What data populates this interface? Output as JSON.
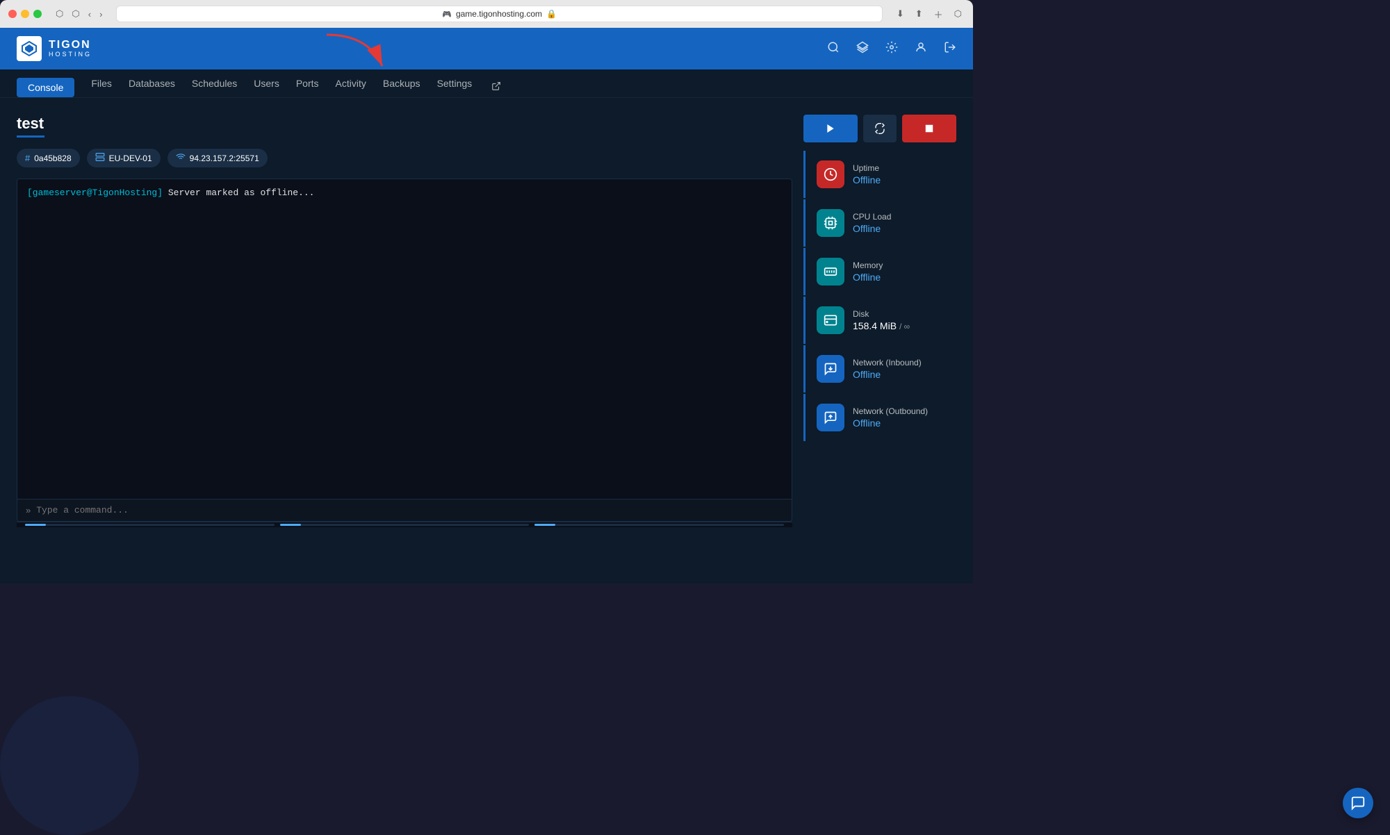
{
  "browser": {
    "url": "game.tigonhosting.com",
    "lock_icon": "🔒"
  },
  "brand": {
    "name": "TIGON",
    "sub": "HOSTING",
    "icon": "🎮"
  },
  "nav": {
    "icons": [
      "search",
      "layers",
      "settings",
      "account",
      "logout"
    ]
  },
  "tabs": [
    {
      "label": "Console",
      "active": true
    },
    {
      "label": "Files",
      "active": false
    },
    {
      "label": "Databases",
      "active": false
    },
    {
      "label": "Schedules",
      "active": false
    },
    {
      "label": "Users",
      "active": false
    },
    {
      "label": "Ports",
      "active": false
    },
    {
      "label": "Activity",
      "active": false
    },
    {
      "label": "Backups",
      "active": false
    },
    {
      "label": "Settings",
      "active": false
    }
  ],
  "server": {
    "name": "test",
    "id": "0a45b828",
    "node": "EU-DEV-01",
    "ip": "94.23.157.2:25571"
  },
  "console": {
    "prompt": "[gameserver@TigonHosting]",
    "message": " Server marked as offline...",
    "placeholder": "Type a command..."
  },
  "controls": {
    "play_label": "▶",
    "restart_label": "↺",
    "stop_label": "■"
  },
  "stats": [
    {
      "label": "Uptime",
      "value": "Offline",
      "icon": "⏰",
      "icon_style": "red",
      "value_style": "blue"
    },
    {
      "label": "CPU Load",
      "value": "Offline",
      "icon": "⚡",
      "icon_style": "teal",
      "value_style": "blue"
    },
    {
      "label": "Memory",
      "value": "Offline",
      "icon": "💾",
      "icon_style": "teal",
      "value_style": "blue"
    },
    {
      "label": "Disk",
      "value": "158.4 MiB",
      "value_suffix": " / ∞",
      "icon": "🖴",
      "icon_style": "teal",
      "value_style": "white"
    },
    {
      "label": "Network (Inbound)",
      "value": "Offline",
      "icon": "↓",
      "icon_style": "blue",
      "value_style": "blue"
    },
    {
      "label": "Network (Outbound)",
      "value": "Offline",
      "icon": "↑",
      "icon_style": "blue",
      "value_style": "blue"
    }
  ],
  "chat_button": "💬"
}
